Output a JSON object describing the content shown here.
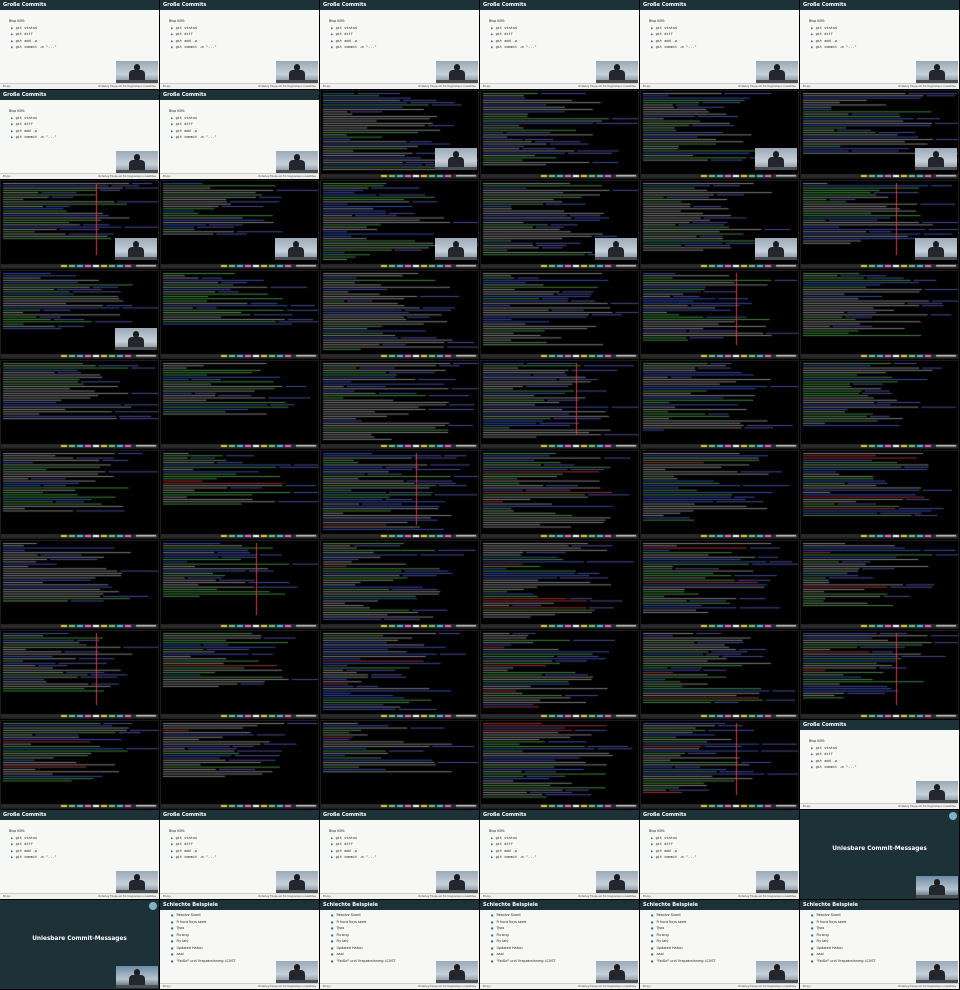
{
  "slide": {
    "title": "Große Commits",
    "heading": "Bisp KIRI:",
    "items": [
      "git status",
      "git diff",
      "git add -p",
      "git commit -m \"...\""
    ],
    "footer_left": "Bruyn",
    "footer_right": "Orderley Eiuge ein für Kaypazieyu unaeltdes"
  },
  "section": {
    "title": "Unlesbare Commit-Messages"
  },
  "bad_slide": {
    "title": "Schlechte Beispiele",
    "items": [
      "Resolve Snord",
      "R front fixys seed",
      "Typo",
      "Fix bug",
      "Fiy iaty",
      "Updated Hallon",
      "aaol",
      "\"FeiGd\" und Vrapasminnmg LCUST"
    ],
    "footer_left": "Bruyn",
    "footer_right": "Orderley Eiuge ein für Kaypazieyu unaeltdes"
  },
  "tiles": [
    "slide",
    "slide",
    "slide",
    "slide",
    "slide",
    "slide",
    "slide",
    "slide",
    "term",
    "term",
    "term",
    "term",
    "term",
    "term",
    "term",
    "term",
    "term",
    "term",
    "term",
    "term",
    "term",
    "term",
    "term",
    "term",
    "term",
    "term",
    "term",
    "term",
    "term",
    "term",
    "term",
    "term",
    "term",
    "term",
    "term",
    "term",
    "term",
    "term",
    "term",
    "term",
    "term",
    "term",
    "term",
    "term",
    "term",
    "term",
    "term",
    "term",
    "term",
    "term",
    "term",
    "term",
    "term",
    "slide",
    "slide",
    "slide",
    "slide",
    "slide",
    "slide",
    "section",
    "section",
    "bad",
    "bad",
    "bad",
    "bad",
    "bad"
  ],
  "pip_on_term": [
    8,
    10,
    11,
    12,
    13,
    14,
    15,
    16,
    17,
    18
  ],
  "colors": {
    "slide_bar": "#1d3138",
    "slide_bg": "#f7f7f5",
    "accent": "#2f6e80",
    "term_text_green": "#59c35a",
    "term_text_blue": "#4e6cf0",
    "term_text_red": "#e04545",
    "status_bar_colors": [
      "#e8c84b",
      "#6ad06a",
      "#47c2e6",
      "#e06bd0",
      "#ffffff"
    ]
  }
}
